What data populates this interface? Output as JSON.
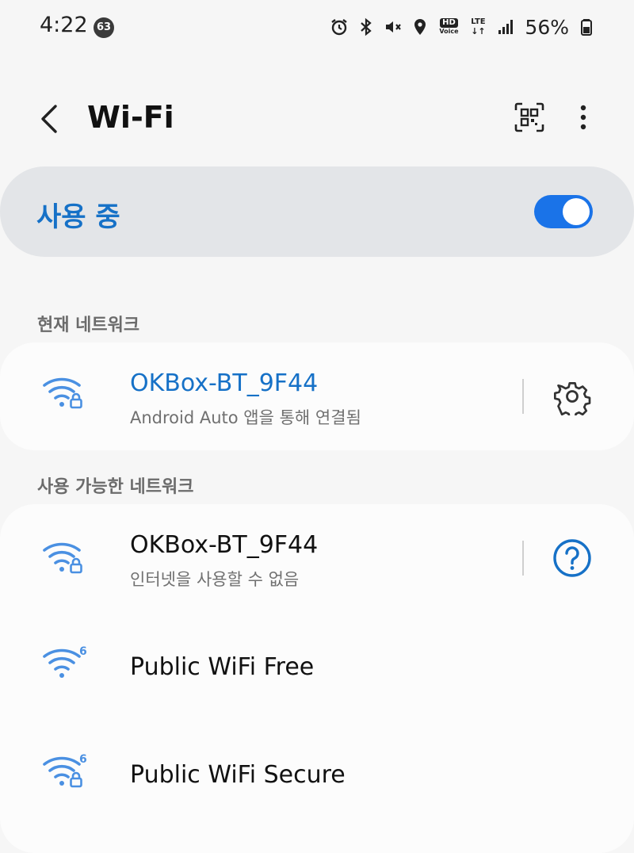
{
  "status_bar": {
    "time": "4:22",
    "notification_count": "63",
    "battery": "56%",
    "icons": [
      "alarm-icon",
      "bluetooth-icon",
      "vibrate-icon",
      "location-icon",
      "hd-voice-icon",
      "lte-icon",
      "signal-icon",
      "battery-icon"
    ],
    "hd_voice": {
      "top": "HD",
      "bottom": "Voice"
    },
    "lte": {
      "top": "LTE",
      "bottom": "↓↑"
    }
  },
  "header": {
    "title": "Wi-Fi",
    "back_icon": "chevron-left-icon",
    "qr_icon": "qr-code-scan-icon",
    "more_icon": "more-vertical-icon"
  },
  "master_switch": {
    "label": "사용 중",
    "state": "on"
  },
  "current_network": {
    "section_title": "현재 네트워크",
    "name": "OKBox-BT_9F44",
    "status": "Android Auto 앱을 통해 연결됨",
    "icon": "wifi-secured-icon",
    "action_icon": "gear-icon"
  },
  "available_networks": {
    "section_title": "사용 가능한 네트워크",
    "items": [
      {
        "name": "OKBox-BT_9F44",
        "status": "인터넷을 사용할 수 없음",
        "icon": "wifi-secured-icon",
        "action_icon": "help-circle-icon"
      },
      {
        "name": "Public WiFi Free",
        "icon": "wifi6-icon",
        "badge": "6"
      },
      {
        "name": "Public WiFi Secure",
        "icon": "wifi6-secured-icon",
        "badge": "6"
      }
    ]
  },
  "colors": {
    "accent": "#1671c7",
    "toggle_on": "#1a73e8",
    "wifi_icon": "#4a90e2",
    "background": "#f6f6f6",
    "master_bg": "#e3e5e8"
  }
}
